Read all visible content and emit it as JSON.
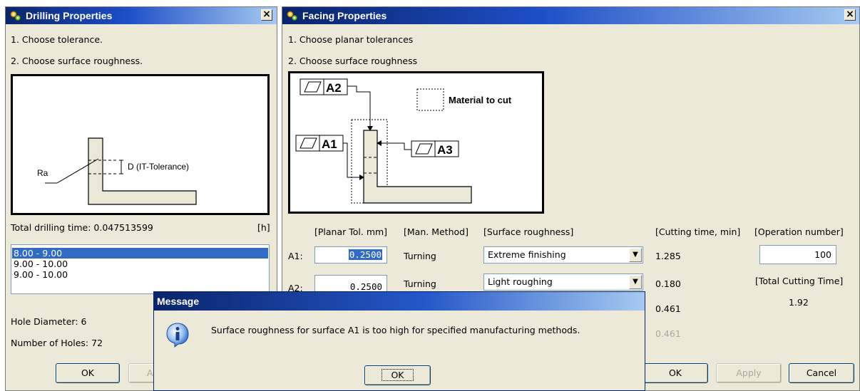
{
  "drilling": {
    "title": "Drilling Properties",
    "close_glyph": "×",
    "step1": "1. Choose tolerance.",
    "step2": "2. Choose surface roughness.",
    "diagram": {
      "ra_label": "Ra",
      "d_label": "D (IT-Tolerance)"
    },
    "total_time_label": "Total drilling time: 0.047513599",
    "time_unit": "[h]",
    "list_items": [
      "8.00 - 9.00",
      "9.00 - 10.00",
      "9.00 - 10.00"
    ],
    "hole_diameter": "Hole Diameter: 6",
    "number_of_holes": "Number of Holes: 72",
    "ok_label": "OK",
    "apply_label": "A"
  },
  "facing": {
    "title": "Facing Properties",
    "close_glyph": "×",
    "step1": "1. Choose planar tolerances",
    "step2": "2. Choose surface roughness",
    "diagram": {
      "a2": "A2",
      "a1": "A1",
      "a3": "A3",
      "legend": "Material to cut"
    },
    "headers": {
      "planar_tol": "[Planar Tol. mm]",
      "man_method": "[Man. Method]",
      "surface_roughness": "[Surface roughness]",
      "cutting_time": "[Cutting time, min]",
      "operation_number": "[Operation number]"
    },
    "rows": [
      {
        "label": "A1:",
        "tol": "0.2500",
        "method": "Turning",
        "roughness": "Extreme finishing",
        "time": "1.285"
      },
      {
        "label": "A2:",
        "tol": "0.2500",
        "method": "Turning",
        "roughness": "Light roughing",
        "time": "0.180"
      }
    ],
    "extra_times": [
      "0.461",
      "0.461"
    ],
    "operation_number": "100",
    "total_cutting_label": "[Total Cutting Time]",
    "total_cutting_value": "1.92",
    "ok_label": "OK",
    "apply_label": "Apply",
    "cancel_label": "Cancel"
  },
  "message": {
    "title": "Message",
    "text": "Surface roughness for surface A1 is too high for specified manufacturing methods.",
    "ok_label": "OK",
    "icon": "info-icon"
  },
  "colors": {
    "titlebar_start": "#0a246a",
    "titlebar_end": "#a6caf0",
    "dialog_bg": "#ece9d8",
    "selection": "#316ac5",
    "part_fill": "#ece8d8"
  }
}
